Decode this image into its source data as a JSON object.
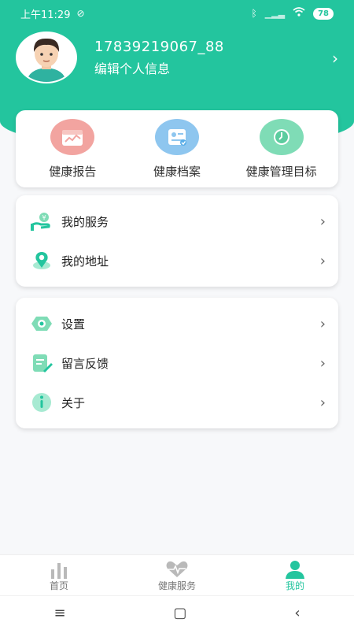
{
  "status": {
    "time": "上午11:29",
    "battery": "78",
    "icons": [
      "alarm-off-icon",
      "bluetooth-icon",
      "signal-icon",
      "wifi-icon",
      "battery-icon"
    ]
  },
  "profile": {
    "name": "17839219067_88",
    "edit_label": "编辑个人信息"
  },
  "quick": [
    {
      "label": "健康报告",
      "icon": "health-report-icon",
      "color": "#f2a4a0"
    },
    {
      "label": "健康档案",
      "icon": "health-record-icon",
      "color": "#8ec6ef"
    },
    {
      "label": "健康管理目标",
      "icon": "clock-goal-icon",
      "color": "#7fdcb6"
    }
  ],
  "menu_group_1": [
    {
      "label": "我的服务",
      "icon": "service-hand-icon"
    },
    {
      "label": "我的地址",
      "icon": "location-pin-icon"
    }
  ],
  "menu_group_2": [
    {
      "label": "设置",
      "icon": "settings-gear-icon"
    },
    {
      "label": "留言反馈",
      "icon": "feedback-edit-icon"
    },
    {
      "label": "关于",
      "icon": "info-icon"
    }
  ],
  "tabs": [
    {
      "label": "首页",
      "icon": "bar-chart-icon"
    },
    {
      "label": "健康服务",
      "icon": "heart-pulse-icon"
    },
    {
      "label": "我的",
      "icon": "person-icon",
      "active": true
    }
  ],
  "colors": {
    "accent": "#23c59e"
  }
}
